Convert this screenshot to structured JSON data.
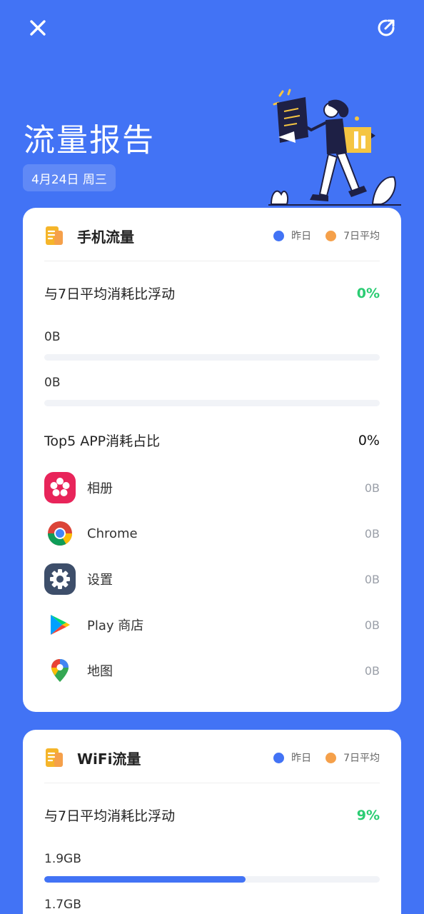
{
  "header": {
    "title": "流量报告",
    "date": "4月24日 周三"
  },
  "colors": {
    "background": "#4273f5",
    "yesterday": "#4273f5",
    "avg7": "#f5a04a",
    "positive": "#2bcc73"
  },
  "mobile": {
    "title": "手机流量",
    "legend_yesterday": "昨日",
    "legend_avg": "7日平均",
    "compare_label": "与7日平均消耗比浮动",
    "compare_value": "0%",
    "yesterday_value": "0B",
    "yesterday_fill": 0,
    "avg_value": "0B",
    "avg_fill": 0,
    "top5_label": "Top5 APP消耗占比",
    "top5_value": "0%",
    "apps": [
      {
        "name": "相册",
        "size": "0B",
        "icon": "gallery-icon"
      },
      {
        "name": "Chrome",
        "size": "0B",
        "icon": "chrome-icon"
      },
      {
        "name": "设置",
        "size": "0B",
        "icon": "settings-gear-icon"
      },
      {
        "name": "Play 商店",
        "size": "0B",
        "icon": "play-store-icon"
      },
      {
        "name": "地图",
        "size": "0B",
        "icon": "maps-pin-icon"
      }
    ]
  },
  "wifi": {
    "title": "WiFi流量",
    "legend_yesterday": "昨日",
    "legend_avg": "7日平均",
    "compare_label": "与7日平均消耗比浮动",
    "compare_value": "9%",
    "yesterday_value": "1.9GB",
    "yesterday_fill": 0.6,
    "avg_value": "1.7GB"
  }
}
